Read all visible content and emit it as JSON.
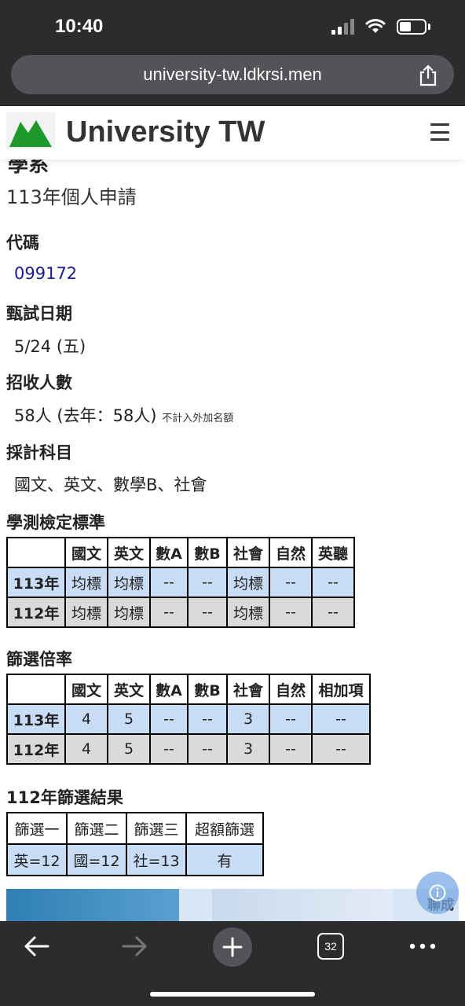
{
  "status_bar": {
    "time": "10:40"
  },
  "browser": {
    "url": "university-tw.ldkrsi.men",
    "tab_count": "32"
  },
  "site": {
    "title": "University TW"
  },
  "page": {
    "clipped_heading": "學系",
    "subtitle": "113年個人申請",
    "code_label": "代碼",
    "code_value": "099172",
    "exam_date_label": "甄試日期",
    "exam_date_value": "5/24 (五)",
    "enroll_label": "招收人數",
    "enroll_value": "58人 (去年：58人)",
    "enroll_note": "不計入外加名額",
    "subjects_label": "採計科目",
    "subjects_value": "國文、英文、數學B、社會"
  },
  "standards": {
    "title": "學測檢定標準",
    "headers": [
      "",
      "國文",
      "英文",
      "數A",
      "數B",
      "社會",
      "自然",
      "英聽"
    ],
    "rows": [
      [
        "113年",
        "均標",
        "均標",
        "--",
        "--",
        "均標",
        "--",
        "--"
      ],
      [
        "112年",
        "均標",
        "均標",
        "--",
        "--",
        "均標",
        "--",
        "--"
      ]
    ]
  },
  "ratio": {
    "title": "篩選倍率",
    "headers": [
      "",
      "國文",
      "英文",
      "數A",
      "數B",
      "社會",
      "自然",
      "相加項"
    ],
    "rows": [
      [
        "113年",
        "4",
        "5",
        "--",
        "--",
        "3",
        "--",
        "--"
      ],
      [
        "112年",
        "4",
        "5",
        "--",
        "--",
        "3",
        "--",
        "--"
      ]
    ]
  },
  "results": {
    "title": "112年篩選結果",
    "headers": [
      "篩選一",
      "篩選二",
      "篩選三",
      "超額篩選"
    ],
    "row": [
      "英=12",
      "國=12",
      "社=13",
      "有"
    ]
  },
  "ad": {
    "text": "聯成"
  }
}
